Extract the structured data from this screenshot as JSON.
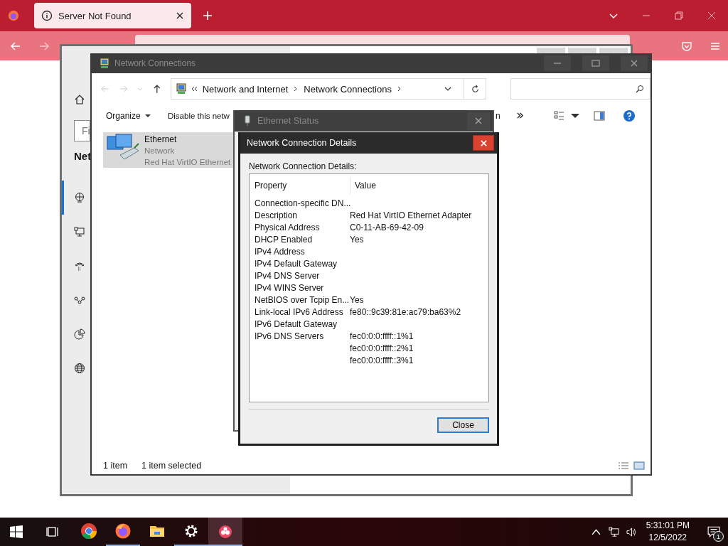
{
  "browser": {
    "tabs": [
      {
        "title": "Server Not Found",
        "selected": true
      }
    ]
  },
  "settings_window": {
    "search_placeholder": "Fi",
    "heading": "Net",
    "nav": [
      {
        "kind": "status",
        "selected": true
      },
      {
        "kind": "ethernet",
        "selected": false
      },
      {
        "kind": "dialup",
        "selected": false
      },
      {
        "kind": "vpn",
        "selected": false
      },
      {
        "kind": "usage",
        "selected": false
      },
      {
        "kind": "proxy",
        "selected": false
      }
    ]
  },
  "explorer": {
    "title": "Network Connections",
    "breadcrumb": [
      "Network and Internet",
      "Network Connections"
    ],
    "toolbar": [
      "Organize",
      "Disable this netw",
      "n"
    ],
    "items": [
      {
        "name": "Ethernet",
        "status": "Network",
        "device": "Red Hat VirtIO Ethernet",
        "selected": true
      }
    ],
    "status": [
      "1 item",
      "1 item selected"
    ]
  },
  "ethernet_status": {
    "title": "Ethernet Status"
  },
  "details": {
    "title": "Network Connection Details",
    "label": "Network Connection Details:",
    "columns": [
      "Property",
      "Value"
    ],
    "rows": [
      {
        "property": "Connection-specific DN..."
      },
      {
        "property": "Description",
        "value": "Red Hat VirtIO Ethernet Adapter"
      },
      {
        "property": "Physical Address",
        "value": "C0-11-AB-69-42-09"
      },
      {
        "property": "DHCP Enabled",
        "value": "Yes"
      },
      {
        "property": "IPv4 Address"
      },
      {
        "property": "IPv4 Default Gateway"
      },
      {
        "property": "IPv4 DNS Server"
      },
      {
        "property": "IPv4 WINS Server"
      },
      {
        "property": "NetBIOS over Tcpip En...",
        "value": "Yes"
      },
      {
        "property": "Link-local IPv6 Address",
        "value": "fe80::9c39:81e:ac79:ba63%2"
      },
      {
        "property": "IPv6 Default Gateway"
      },
      {
        "property": "IPv6 DNS Servers",
        "value": "fec0:0:0:ffff::1%1"
      },
      {
        "value": "fec0:0:0:ffff::2%1"
      },
      {
        "value": "fec0:0:0:ffff::3%1"
      }
    ],
    "close": "Close"
  },
  "taskbar": {
    "apps": [
      {
        "kind": "chrome",
        "running": false,
        "selected": false
      },
      {
        "kind": "firefox",
        "running": true,
        "selected": false
      },
      {
        "kind": "folder",
        "running": false,
        "selected": false
      },
      {
        "kind": "settings",
        "running": true,
        "selected": false
      },
      {
        "kind": "app",
        "running": true,
        "selected": true
      }
    ],
    "time": "5:31:01 PM",
    "date": "12/5/2022",
    "notifications": "1"
  }
}
